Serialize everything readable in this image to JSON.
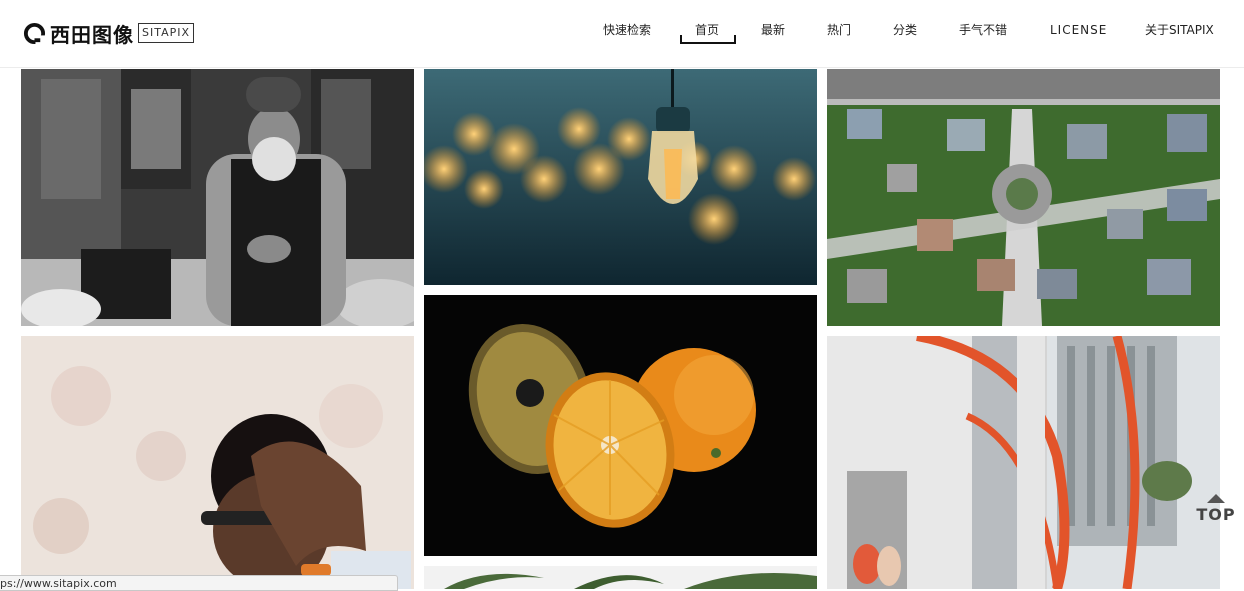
{
  "brand": {
    "name_cn": "西田图像",
    "name_en": "SITAPIX"
  },
  "nav": [
    {
      "label": "快速检索"
    },
    {
      "label": "首页"
    },
    {
      "label": "最新"
    },
    {
      "label": "热门"
    },
    {
      "label": "分类"
    },
    {
      "label": "手气不错"
    },
    {
      "label": "LICENSE"
    },
    {
      "label": "关于SITAPIX"
    }
  ],
  "active_nav": "首页",
  "gallery": [
    {
      "subject": "elderly man with beard looking at phone, black and white"
    },
    {
      "subject": "hanging edison light bulb with bokeh lights"
    },
    {
      "subject": "aerial view of suburban houses around roundabout"
    },
    {
      "subject": "man holding head in hand wearing glasses"
    },
    {
      "subject": "sliced orange halves on black background"
    },
    {
      "subject": "two women sitting by tall buildings with red curved sculpture"
    },
    {
      "subject": "palm tree fronds"
    }
  ],
  "back_to_top": {
    "label": "TOP"
  },
  "status": {
    "url": "ps://www.sitapix.com"
  },
  "colors": {
    "accent": "#111111",
    "background": "#ffffff"
  }
}
